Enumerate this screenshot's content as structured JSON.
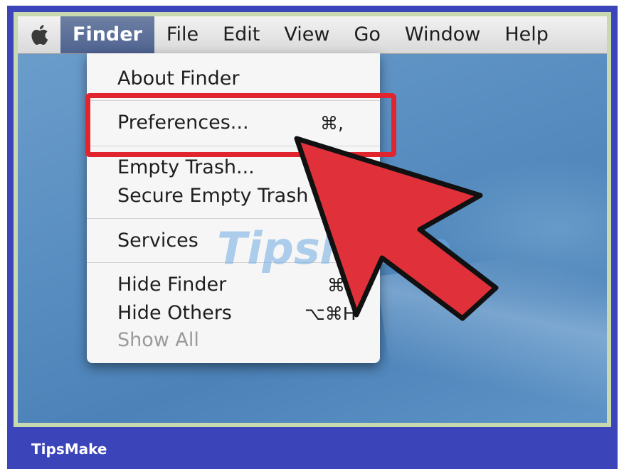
{
  "menubar": {
    "items": [
      {
        "label": "Finder",
        "active": true
      },
      {
        "label": "File"
      },
      {
        "label": "Edit"
      },
      {
        "label": "View"
      },
      {
        "label": "Go"
      },
      {
        "label": "Window"
      },
      {
        "label": "Help"
      }
    ],
    "apple_icon": "apple-logo-icon"
  },
  "finder_menu": {
    "about": "About Finder",
    "preferences": "Preferences...",
    "preferences_shortcut": "⌘,",
    "empty_trash": "Empty Trash...",
    "secure_empty_trash": "Secure Empty Trash",
    "services": "Services",
    "hide_finder": "Hide Finder",
    "hide_finder_shortcut": "⌘H",
    "hide_others": "Hide Others",
    "hide_others_shortcut": "⌥⌘H",
    "show_all": "Show All"
  },
  "annotation": {
    "highlight_color": "#e0252e",
    "arrow_color": "#e0303a",
    "arrow_icon": "pointer-arrow-icon"
  },
  "watermark": "TipsMake",
  "footer": {
    "brand": "TipsMake",
    "background": "#3b44b8"
  }
}
